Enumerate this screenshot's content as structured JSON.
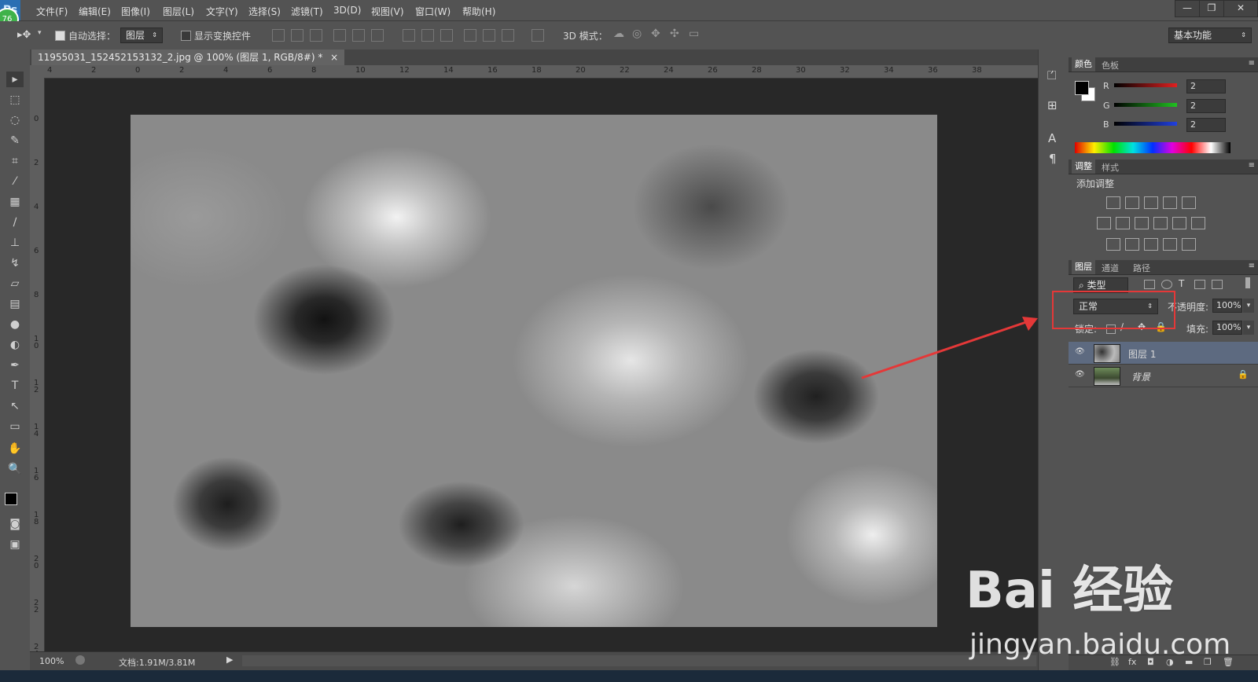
{
  "app": {
    "logo_text": "Ps",
    "badge_text": "76",
    "menu": [
      "文件(F)",
      "编辑(E)",
      "图像(I)",
      "图层(L)",
      "文字(Y)",
      "选择(S)",
      "滤镜(T)",
      "3D(D)",
      "视图(V)",
      "窗口(W)",
      "帮助(H)"
    ],
    "window_controls": {
      "minimize": "—",
      "restore": "❐",
      "close": "✕"
    }
  },
  "options_bar": {
    "auto_select_label": "自动选择：",
    "auto_select_checked": true,
    "auto_select_target": "图层",
    "show_transform_label": "显示变换控件",
    "show_transform_checked": false,
    "mode_3d_label": "3D 模式：",
    "workspace": "基本功能"
  },
  "document": {
    "tab_title": "11955031_152452153132_2.jpg @ 100% (图层 1, RGB/8#) *",
    "close_glyph": "×",
    "hruler_labels": [
      "4",
      "2",
      "0",
      "2",
      "4",
      "6",
      "8",
      "10",
      "12",
      "14",
      "16",
      "18",
      "20",
      "22",
      "24",
      "26",
      "28",
      "30",
      "32",
      "34",
      "36",
      "38"
    ],
    "vruler_labels": [
      "0",
      "2",
      "4",
      "6",
      "8",
      "10",
      "12",
      "14",
      "16",
      "18",
      "20",
      "22",
      "24"
    ],
    "zoom": "100%",
    "doc_info": "文档:1.91M/3.81M"
  },
  "color_panel": {
    "tabs": [
      "颜色",
      "色板"
    ],
    "channels": [
      {
        "name": "R",
        "value": "2",
        "color": "#e02020"
      },
      {
        "name": "G",
        "value": "2",
        "color": "#20c020"
      },
      {
        "name": "B",
        "value": "2",
        "color": "#2040e0"
      }
    ]
  },
  "adjust_panel": {
    "tabs": [
      "调整",
      "样式"
    ],
    "title": "添加调整"
  },
  "layers_panel": {
    "tabs": [
      "图层",
      "通道",
      "路径"
    ],
    "filter_kind": "类型",
    "blend_mode": "正常",
    "opacity_label": "不透明度:",
    "opacity_value": "100%",
    "lock_label": "锁定:",
    "fill_label": "填充:",
    "fill_value": "100%",
    "layers": [
      {
        "name": "图层 1",
        "selected": true
      },
      {
        "name": "背景",
        "selected": false,
        "locked": true
      }
    ]
  },
  "watermark": {
    "brand": "Bai 经验",
    "url": "jingyan.baidu.com"
  },
  "annotation": {
    "color": "#e43838"
  }
}
